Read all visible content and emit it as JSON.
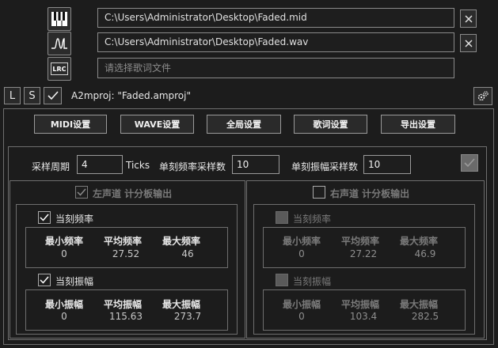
{
  "files": {
    "midi_path": "C:\\Users\\Administrator\\Desktop\\Faded.mid",
    "wav_path": "C:\\Users\\Administrator\\Desktop\\Faded.wav",
    "lyric_placeholder": "请选择歌词文件",
    "lrc_icon_text": "LRC"
  },
  "toolbar": {
    "load_label": "L",
    "save_label": "S",
    "project_text": "A2mproj: \"Faded.amproj\""
  },
  "tabs": [
    "MIDI设置",
    "WAVE设置",
    "全局设置",
    "歌词设置",
    "导出设置"
  ],
  "sampling": {
    "period_label": "采样周期",
    "period_value": "4",
    "ticks_label": "Ticks",
    "freq_samples_label": "单刻频率采样数",
    "freq_samples_value": "10",
    "amp_samples_label": "单刻振幅采样数",
    "amp_samples_value": "10"
  },
  "left": {
    "title": "左声道 计分板输出",
    "freq_label": "当刻频率",
    "amp_label": "当刻振幅",
    "freq_stats": {
      "min_label": "最小频率",
      "min": "0",
      "avg_label": "平均频率",
      "avg": "27.52",
      "max_label": "最大频率",
      "max": "46"
    },
    "amp_stats": {
      "min_label": "最小振幅",
      "min": "0",
      "avg_label": "平均振幅",
      "avg": "115.63",
      "max_label": "最大振幅",
      "max": "273.7"
    }
  },
  "right": {
    "title": "右声道 计分板输出",
    "freq_label": "当刻频率",
    "amp_label": "当刻振幅",
    "freq_stats": {
      "min_label": "最小频率",
      "min": "0",
      "avg_label": "平均频率",
      "avg": "27.22",
      "max_label": "最大频率",
      "max": "46.9"
    },
    "amp_stats": {
      "min_label": "最小振幅",
      "min": "0",
      "avg_label": "平均振幅",
      "avg": "103.4",
      "max_label": "最大振幅",
      "max": "282.5"
    }
  },
  "colors": {
    "check_active": "#ffffff",
    "check_disabled": "#7a7a7a",
    "background": "#1c1c1c"
  }
}
